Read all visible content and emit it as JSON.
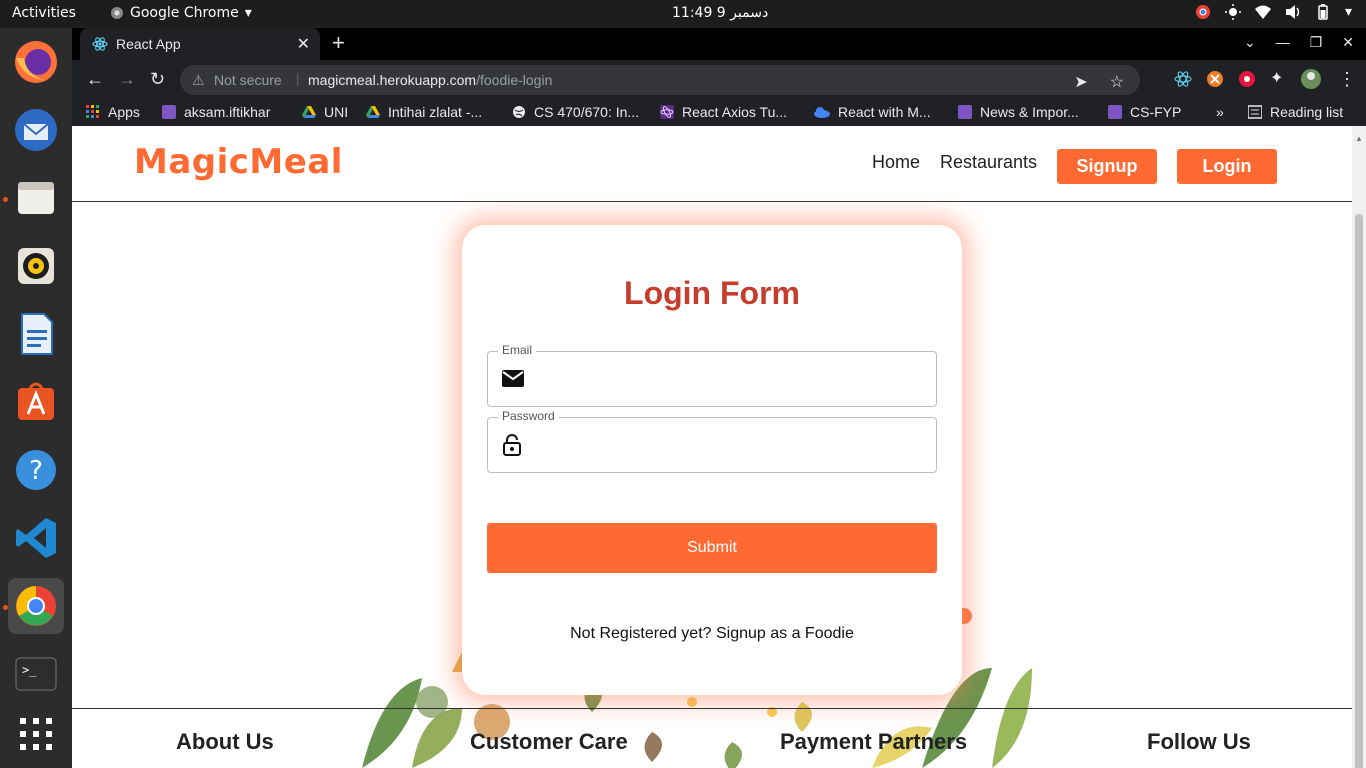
{
  "desktop": {
    "activities": "Activities",
    "app_name": "Google Chrome",
    "clock": "11:49  دسمبر 9"
  },
  "browser": {
    "tab_title": "React App",
    "new_tab": "+",
    "security_label": "Not secure",
    "url_host": "magicmeal.herokuapp.com",
    "url_path": "/foodie-login",
    "bookmarks": [
      {
        "label": "Apps",
        "color": "#ea4335"
      },
      {
        "label": "aksam.iftikhar",
        "color": "#7e57c2"
      },
      {
        "label": "UNI",
        "color": "#fbbc05"
      },
      {
        "label": "Intihai zlalat -...",
        "color": "#fbbc05"
      },
      {
        "label": "CS 470/670: In...",
        "color": "#e8eaed"
      },
      {
        "label": "React Axios Tu...",
        "color": "#9c27b0"
      },
      {
        "label": "React with M...",
        "color": "#4285f4"
      },
      {
        "label": "News & Impor...",
        "color": "#7e57c2"
      },
      {
        "label": "CS-FYP",
        "color": "#7e57c2"
      }
    ],
    "overflow": "»",
    "reading_list": "Reading list"
  },
  "site": {
    "logo": "MagicMeal",
    "nav": {
      "home": "Home",
      "restaurants": "Restaurants",
      "signup": "Signup",
      "login": "Login"
    },
    "form": {
      "title": "Login Form",
      "email_label": "Email",
      "email_value": "",
      "password_label": "Password",
      "password_value": "",
      "submit": "Submit",
      "register_text": "Not Registered yet? Signup as a Foodie"
    },
    "footer": {
      "about": "About Us",
      "care": "Customer Care",
      "payment": "Payment Partners",
      "follow": "Follow Us"
    }
  },
  "colors": {
    "brand": "#ff6a33",
    "title": "#c43d2d"
  }
}
